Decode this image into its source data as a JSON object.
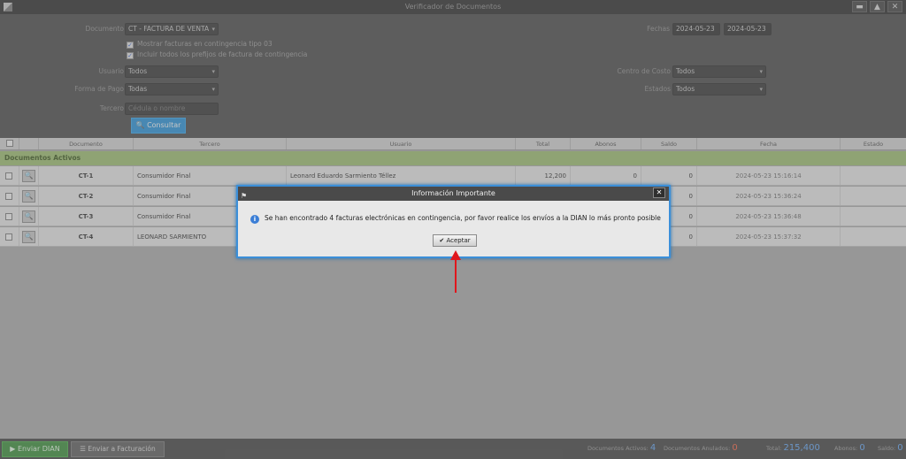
{
  "window": {
    "title": "Verificador de Documentos",
    "controls": [
      "▬",
      "▲",
      "✕"
    ]
  },
  "filters": {
    "documento": {
      "label": "Documento",
      "value": "CT - FACTURA DE VENTA"
    },
    "check1": "Mostrar facturas en contingencia tipo 03",
    "check2": "Incluir todos los prefijos de factura de contingencia",
    "fechas": {
      "label": "Fechas",
      "from": "2024-05-23",
      "to": "2024-05-23"
    },
    "usuario": {
      "label": "Usuario",
      "value": "Todos"
    },
    "forma_pago": {
      "label": "Forma de Pago",
      "value": "Todas"
    },
    "tercero": {
      "label": "Tercero",
      "placeholder": "Cédula o nombre"
    },
    "centro_costo": {
      "label": "Centro de Costo",
      "value": "Todos"
    },
    "estados": {
      "label": "Estados",
      "value": "Todos"
    },
    "consultar": "Consultar"
  },
  "table": {
    "headers": [
      "Documento",
      "Tercero",
      "Usuario",
      "Total",
      "Abonos",
      "Saldo",
      "Fecha",
      "Estado"
    ],
    "section": "Documentos Activos",
    "rows": [
      {
        "doc": "CT-1",
        "tercero": "Consumidor Final",
        "usuario": "Leonard Eduardo Sarmiento Téllez",
        "total": "12,200",
        "abonos": "0",
        "saldo": "0",
        "fecha": "2024-05-23 15:16:14"
      },
      {
        "doc": "CT-2",
        "tercero": "Consumidor Final",
        "usuario": "",
        "total": "",
        "abonos": "",
        "saldo": "0",
        "fecha": "2024-05-23 15:36:24"
      },
      {
        "doc": "CT-3",
        "tercero": "Consumidor Final",
        "usuario": "",
        "total": "",
        "abonos": "",
        "saldo": "0",
        "fecha": "2024-05-23 15:36:48"
      },
      {
        "doc": "CT-4",
        "tercero": "LEONARD SARMIENTO",
        "usuario": "",
        "total": "",
        "abonos": "",
        "saldo": "0",
        "fecha": "2024-05-23 15:37:32"
      }
    ]
  },
  "dialog": {
    "title": "Información Importante",
    "message": "Se han encontrado 4 facturas electrónicas en contingencia, por favor realice los envíos a la DIAN lo más pronto posible",
    "accept": "Aceptar"
  },
  "footer": {
    "enviar_dian": "Enviar DIAN",
    "enviar_facturacion": "Enviar a Facturación",
    "activos_label": "Documentos Activos:",
    "activos_value": "4",
    "anulados_label": "Documentos Anulados:",
    "anulados_value": "0",
    "total_label": "Total:",
    "total_value": "215,400",
    "abonos_label": "Abonos:",
    "abonos_value": "0",
    "saldo_label": "Saldo:",
    "saldo_value": "0"
  },
  "colors": {
    "accent": "#1a8fdc",
    "section": "#9bbf6a",
    "dialog_border": "#3b8fd9",
    "arrow": "#e0161c"
  }
}
